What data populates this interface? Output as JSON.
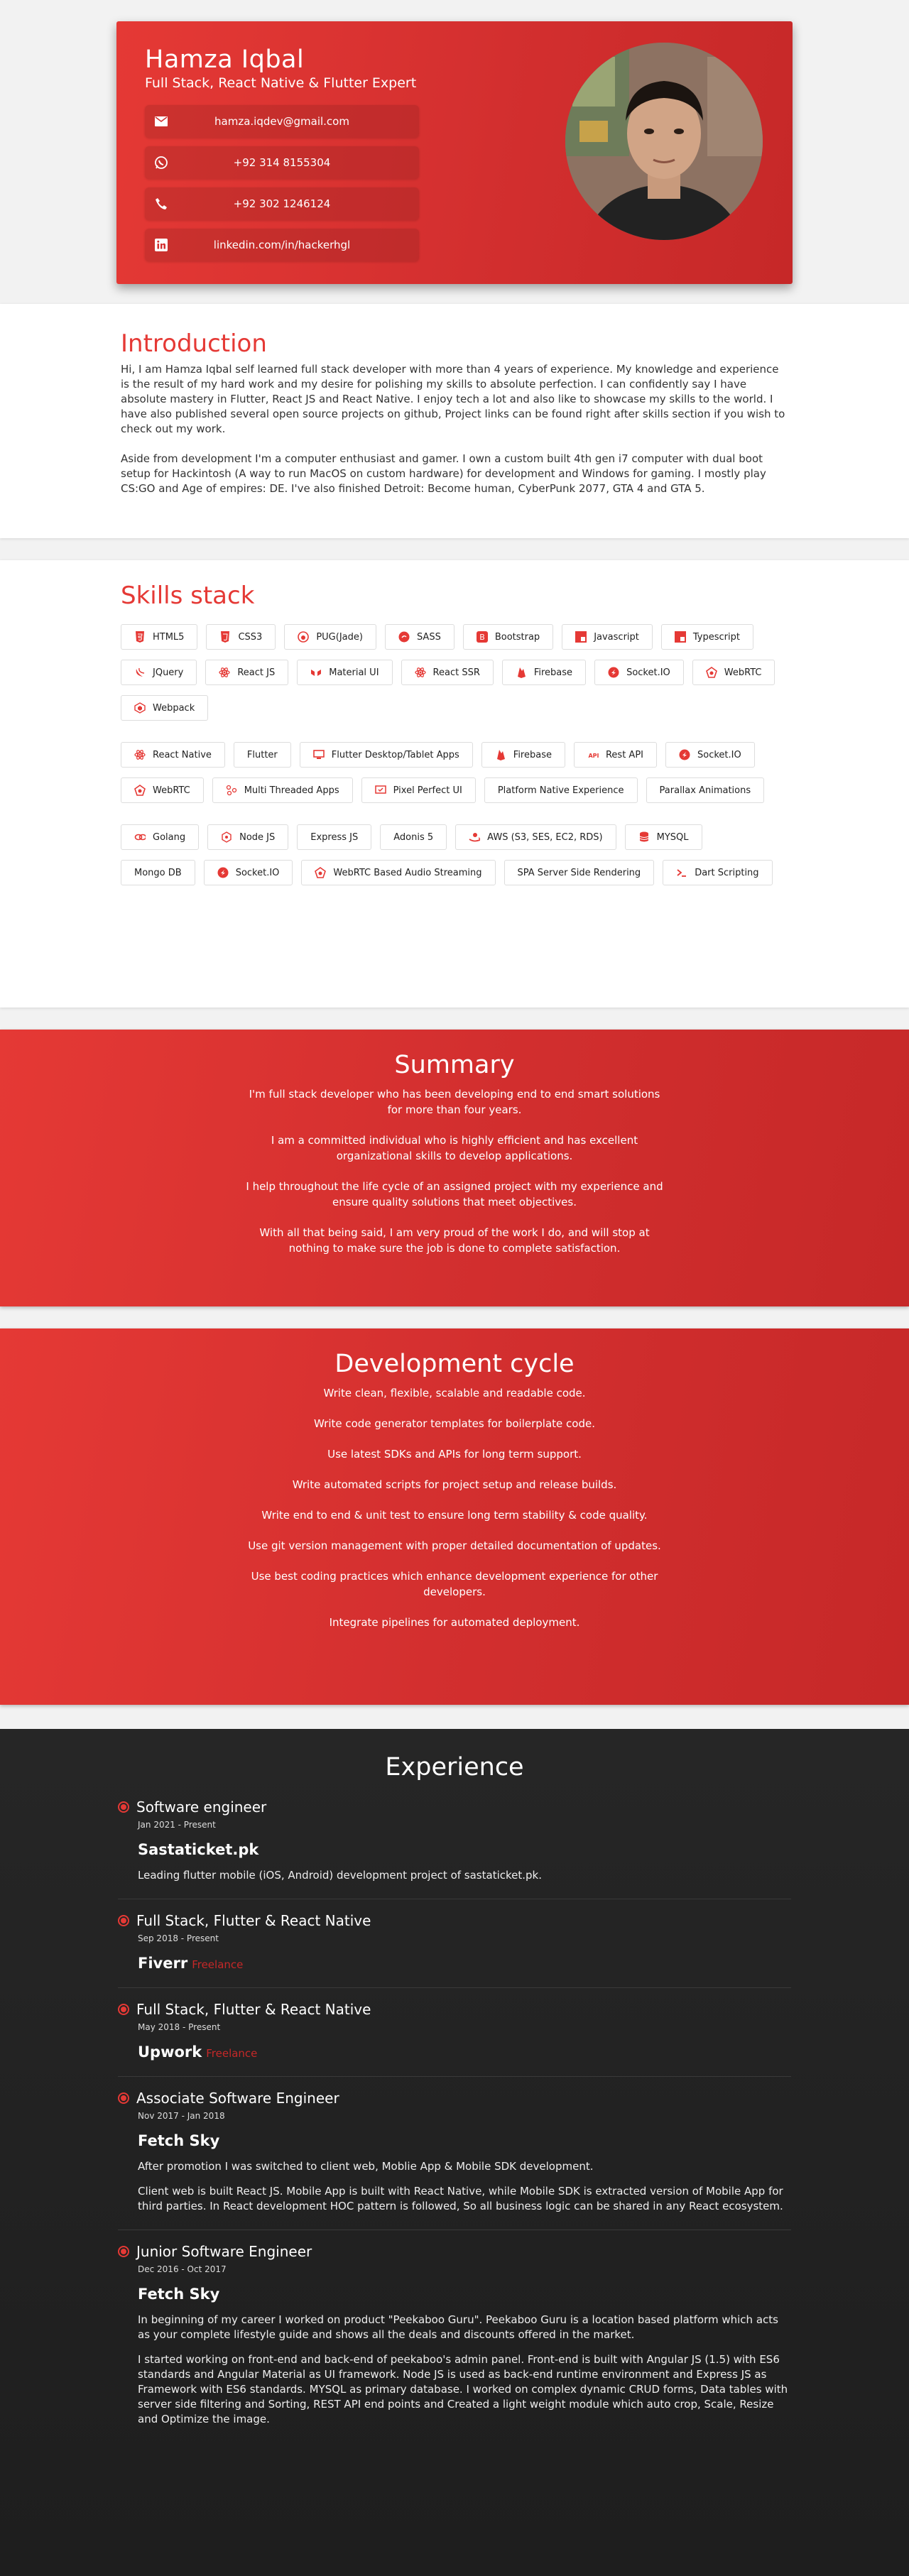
{
  "header": {
    "name": "Hamza Iqbal",
    "subtitle": "Full Stack, React Native & Flutter Expert",
    "contacts": [
      {
        "icon": "email-icon",
        "text": "hamza.iqdev@gmail.com"
      },
      {
        "icon": "whatsapp-icon",
        "text": "+92 314 8155304"
      },
      {
        "icon": "phone-icon",
        "text": "+92 302 1246124"
      },
      {
        "icon": "linkedin-icon",
        "text": "linkedin.com/in/hackerhgl"
      }
    ]
  },
  "intro": {
    "title": "Introduction",
    "p1": "Hi, I am Hamza Iqbal self learned full stack developer with more than 4 years of experience. My knowledge and experience is the result of my hard work and my desire for polishing my skills to absolute perfection. I can confidently say I have absolute mastery in Flutter, React JS and React Native. I enjoy tech a lot and also like to showcase my skills to the world. I have also published several open source projects on github, Project links can be found right after skills section if you wish to check out my work.",
    "p2": "Aside from development I'm a computer enthusiast and gamer. I own a custom built 4th gen i7 computer with dual boot setup for Hackintosh (A way to run MacOS on custom hardware) for development and Windows for gaming. I mostly play CS:GO and Age of empires: DE. I've also finished Detroit: Become human, CyberPunk 2077, GTA 4 and GTA 5."
  },
  "skills": {
    "title": "Skills stack",
    "groups": [
      [
        "HTML5",
        "CSS3",
        "PUG(Jade)",
        "SASS",
        "Bootstrap",
        "Javascript",
        "Typescript",
        "JQuery",
        "React JS",
        "Material UI",
        "React SSR",
        "Firebase",
        "Socket.IO",
        "WebRTC",
        "Webpack"
      ],
      [
        "React Native",
        "Flutter",
        "Flutter Desktop/Tablet Apps",
        "Firebase",
        "Rest API",
        "Socket.IO",
        "WebRTC",
        "Multi Threaded Apps",
        "Pixel Perfect UI",
        "Platform Native Experience",
        "Parallax Animations"
      ],
      [
        "Golang",
        "Node JS",
        "Express JS",
        "Adonis 5",
        "AWS (S3, SES, EC2, RDS)",
        "MYSQL",
        "Mongo DB",
        "Socket.IO",
        "WebRTC Based Audio Streaming",
        "SPA Server Side Rendering",
        "Dart Scripting"
      ]
    ],
    "icons": [
      [
        "html5-icon",
        "css3-icon",
        "pug-icon",
        "sass-icon",
        "bootstrap-icon",
        "javascript-icon",
        "typescript-icon",
        "jquery-icon",
        "react-icon",
        "material-ui-icon",
        "react-icon",
        "firebase-icon",
        "socketio-icon",
        "webrtc-icon",
        "webpack-icon"
      ],
      [
        "react-icon",
        "",
        "desktop-icon",
        "firebase-icon",
        "api-icon",
        "socketio-icon",
        "webrtc-icon",
        "threads-icon",
        "pixel-icon",
        "",
        ""
      ],
      [
        "golang-icon",
        "nodejs-icon",
        "",
        "",
        "aws-icon",
        "mysql-icon",
        "",
        "socketio-icon",
        "webrtc-icon",
        "",
        "terminal-icon"
      ]
    ]
  },
  "summary": {
    "title": "Summary",
    "paragraphs": [
      "I'm full stack developer who has been developing end to end smart solutions for more than four years.",
      "I am a committed individual who is highly efficient and has excellent organizational skills to develop applications.",
      "I help throughout the life cycle of an assigned project with my experience and ensure quality solutions that meet objectives.",
      "With all that being said, I am very proud of the work I do, and will stop at nothing to make sure the job is done to complete satisfaction."
    ]
  },
  "devcycle": {
    "title": "Development cycle",
    "items": [
      "Write clean, flexible, scalable and readable code.",
      "Write code generator templates for boilerplate code.",
      "Use latest SDKs and APIs for long term support.",
      "Write automated scripts for project setup and release builds.",
      "Write end to end & unit test to ensure long term stability & code quality.",
      "Use git version management with proper detailed documentation of updates.",
      "Use best coding practices which enhance development experience for other developers.",
      "Integrate pipelines for automated deployment."
    ]
  },
  "experience": {
    "title": "Experience",
    "jobs": [
      {
        "role": "Software engineer",
        "date": "Jan 2021 - Present",
        "company": "Sastaticket.pk",
        "tag": "",
        "desc": [
          "Leading flutter mobile (iOS, Android) development project of sastaticket.pk."
        ]
      },
      {
        "role": "Full Stack, Flutter & React Native",
        "date": "Sep 2018 - Present",
        "company": "Fiverr",
        "tag": "Freelance",
        "desc": []
      },
      {
        "role": "Full Stack, Flutter & React Native",
        "date": "May 2018 - Present",
        "company": "Upwork",
        "tag": "Freelance",
        "desc": []
      },
      {
        "role": "Associate Software Engineer",
        "date": "Nov 2017 - Jan 2018",
        "company": "Fetch Sky",
        "tag": "",
        "desc": [
          "After promotion I was switched to client web, Moblie App & Mobile SDK development.",
          "Client web is built React JS. Mobile App is built with React Native, while Mobile SDK is extracted version of Mobile App for third parties. In React development HOC pattern is followed, So all business logic can be shared in any React ecosystem."
        ]
      },
      {
        "role": "Junior Software Engineer",
        "date": "Dec 2016 - Oct 2017",
        "company": "Fetch Sky",
        "tag": "",
        "desc": [
          "In beginning of my career I worked on product \"Peekaboo Guru\". Peekaboo Guru is a location based platform which acts as your complete lifestyle guide and shows all the deals and discounts offered in the market.",
          "I started working on front-end and back-end of peekaboo's admin panel. Front-end is built with Angular JS (1.5) with ES6 standards and Angular Material as UI framework. Node JS is used as back-end runtime environment and Express JS as Framework with ES6 standards. MYSQL as primary database. I worked on complex dynamic CRUD forms, Data tables with server side filtering and Sorting, REST API end points and Created a light weight module which auto crop, Scale, Resize and Optimize the image."
        ]
      }
    ]
  },
  "colors": {
    "accent": "#e53935",
    "accent_dark": "#c62828",
    "dark_bg": "#222222"
  }
}
